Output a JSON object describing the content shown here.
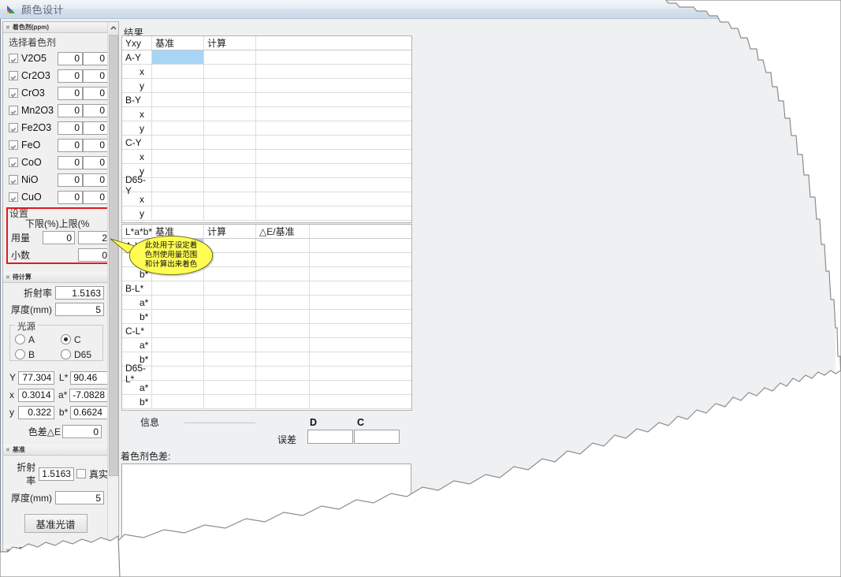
{
  "window": {
    "title": "颜色设计",
    "icon": "color-triangle-icon"
  },
  "left_panel": {
    "colorant_section": {
      "header": "着色剂(ppm)",
      "collapse_icon": "chevron-up-icon",
      "group_label": "选择着色剂",
      "items": [
        {
          "name": "V2O5",
          "lower": "0",
          "upper": "0",
          "checked": true
        },
        {
          "name": "Cr2O3",
          "lower": "0",
          "upper": "0",
          "checked": true
        },
        {
          "name": "CrO3",
          "lower": "0",
          "upper": "0",
          "checked": true
        },
        {
          "name": "Mn2O3",
          "lower": "0",
          "upper": "0",
          "checked": true
        },
        {
          "name": "Fe2O3",
          "lower": "0",
          "upper": "0",
          "checked": true
        },
        {
          "name": "FeO",
          "lower": "0",
          "upper": "0",
          "checked": true
        },
        {
          "name": "CoO",
          "lower": "0",
          "upper": "0",
          "checked": true
        },
        {
          "name": "NiO",
          "lower": "0",
          "upper": "0",
          "checked": true
        },
        {
          "name": "CuO",
          "lower": "0",
          "upper": "0",
          "checked": true
        }
      ]
    },
    "settings": {
      "title": "设置",
      "col_lower": "下限(%)",
      "col_upper": "上限(%",
      "amount_label": "用量",
      "amount_lower": "0",
      "amount_upper": "2",
      "decimal_label": "小数",
      "decimal_value": "0",
      "highlight_color": "#e01b1b"
    },
    "to_calc": {
      "header": "待计算",
      "collapse_icon": "chevron-up-icon",
      "refractive_label": "折射率",
      "refractive_value": "1.5163",
      "thickness_label": "厚度(mm)",
      "thickness_value": "5",
      "light_source": {
        "title": "光源",
        "options": [
          "A",
          "C",
          "B",
          "D65"
        ],
        "selected": "C"
      },
      "measures": [
        {
          "label": "Y",
          "value": "77.304",
          "label2": "L*",
          "value2": "90.46"
        },
        {
          "label": "x",
          "value": "0.3014",
          "label2": "a*",
          "value2": "-7.0828"
        },
        {
          "label": "y",
          "value": "0.322",
          "label2": "b*",
          "value2": "0.6624"
        }
      ],
      "delta_e_label": "色差△E",
      "delta_e_value": "0"
    },
    "standard": {
      "header": "基准",
      "collapse_icon": "chevron-up-icon",
      "refractive_label": "折射率",
      "refractive_value": "1.5163",
      "real_label": "真实",
      "real_checked": false,
      "thickness_label": "厚度(mm)",
      "thickness_value": "5",
      "spectrum_button": "基准光谱"
    },
    "calc_section": {
      "header": "计算",
      "collapse_icon": "chevron-up-icon"
    }
  },
  "results": {
    "title": "结果",
    "yxy_table": {
      "columns": [
        "Yxy",
        "基准",
        "计算"
      ],
      "rows": [
        {
          "label": "A-Y",
          "indent": false,
          "selected": true,
          "base": "",
          "calc": ""
        },
        {
          "label": "x",
          "indent": true,
          "selected": false,
          "base": "",
          "calc": ""
        },
        {
          "label": "y",
          "indent": true,
          "selected": false,
          "base": "",
          "calc": ""
        },
        {
          "label": "B-Y",
          "indent": false,
          "selected": false,
          "base": "",
          "calc": ""
        },
        {
          "label": "x",
          "indent": true,
          "selected": false,
          "base": "",
          "calc": ""
        },
        {
          "label": "y",
          "indent": true,
          "selected": false,
          "base": "",
          "calc": ""
        },
        {
          "label": "C-Y",
          "indent": false,
          "selected": false,
          "base": "",
          "calc": ""
        },
        {
          "label": "x",
          "indent": true,
          "selected": false,
          "base": "",
          "calc": ""
        },
        {
          "label": "y",
          "indent": true,
          "selected": false,
          "base": "",
          "calc": ""
        },
        {
          "label": "D65-Y",
          "indent": false,
          "selected": false,
          "base": "",
          "calc": ""
        },
        {
          "label": "x",
          "indent": true,
          "selected": false,
          "base": "",
          "calc": ""
        },
        {
          "label": "y",
          "indent": true,
          "selected": false,
          "base": "",
          "calc": ""
        }
      ]
    },
    "lab_table": {
      "columns": [
        "L*a*b*",
        "基准",
        "计算",
        "△E/基准"
      ],
      "rows": [
        {
          "label": "A-L*",
          "indent": false,
          "selected": true,
          "base": "",
          "calc": "",
          "de": ""
        },
        {
          "label": "a*",
          "indent": true,
          "selected": false,
          "base": "",
          "calc": "",
          "de": ""
        },
        {
          "label": "b*",
          "indent": true,
          "selected": false,
          "base": "",
          "calc": "",
          "de": ""
        },
        {
          "label": "B-L*",
          "indent": false,
          "selected": false,
          "base": "",
          "calc": "",
          "de": ""
        },
        {
          "label": "a*",
          "indent": true,
          "selected": false,
          "base": "",
          "calc": "",
          "de": ""
        },
        {
          "label": "b*",
          "indent": true,
          "selected": false,
          "base": "",
          "calc": "",
          "de": ""
        },
        {
          "label": "C-L*",
          "indent": false,
          "selected": false,
          "base": "",
          "calc": "",
          "de": ""
        },
        {
          "label": "a*",
          "indent": true,
          "selected": false,
          "base": "",
          "calc": "",
          "de": ""
        },
        {
          "label": "b*",
          "indent": true,
          "selected": false,
          "base": "",
          "calc": "",
          "de": ""
        },
        {
          "label": "D65-L*",
          "indent": false,
          "selected": false,
          "base": "",
          "calc": "",
          "de": ""
        },
        {
          "label": "a*",
          "indent": true,
          "selected": false,
          "base": "",
          "calc": "",
          "de": ""
        },
        {
          "label": "b*",
          "indent": true,
          "selected": false,
          "base": "",
          "calc": "",
          "de": ""
        }
      ]
    }
  },
  "tooltip": {
    "line1": "此处用于设定着",
    "line2": "色剂使用量范围",
    "line3": "和计算出来着色",
    "background": "#fffd54"
  },
  "info": {
    "label": "信息",
    "value": "",
    "col_d": "D",
    "col_c": "C",
    "error_label": "误差",
    "error_d": "",
    "error_c": "",
    "colorant_diff_label": "着色剂色差:",
    "colorant_diff_value": ""
  }
}
